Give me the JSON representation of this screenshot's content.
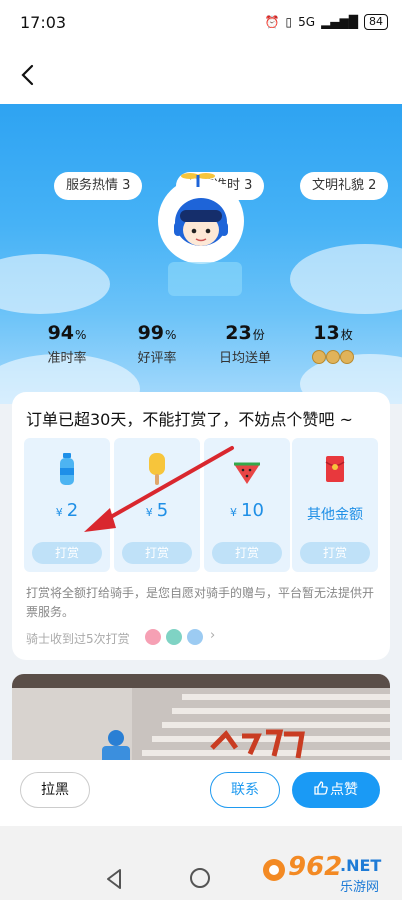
{
  "status": {
    "time": "17:03",
    "network": "5G",
    "battery": "84"
  },
  "tags": [
    "服务热情 3",
    "快速准时 3",
    "文明礼貌 2"
  ],
  "stats": [
    {
      "value": "94",
      "unit": "%",
      "label": "准时率"
    },
    {
      "value": "99",
      "unit": "%",
      "label": "好评率"
    },
    {
      "value": "23",
      "unit": "份",
      "label": "日均送单"
    },
    {
      "value": "13",
      "unit": "枚",
      "label": ""
    }
  ],
  "tip": {
    "title": "订单已超30天，不能打赏了，不妨点个赞吧 ~",
    "options": [
      {
        "yen": "¥",
        "amount": "2",
        "button": "打赏",
        "icon": "water-bottle-icon"
      },
      {
        "yen": "¥",
        "amount": "5",
        "button": "打赏",
        "icon": "popsicle-icon"
      },
      {
        "yen": "¥",
        "amount": "10",
        "button": "打赏",
        "icon": "watermelon-icon"
      },
      {
        "yen": "",
        "amount": "其他金额",
        "button": "打赏",
        "icon": "red-envelope-icon"
      }
    ],
    "disclaimer": "打赏将全额打给骑手，是您自愿对骑手的赠与，平台暂无法提供开票服务。",
    "received": "骑士收到过5次打赏"
  },
  "actions": {
    "block": "拉黑",
    "contact": "联系",
    "like": "点赞"
  },
  "watermark": {
    "num": "962",
    "net": ".NET",
    "sub": "乐游网"
  },
  "colors": {
    "accent": "#1a9af5",
    "hero_top": "#2ea3f2",
    "arrow": "#d9272e"
  }
}
